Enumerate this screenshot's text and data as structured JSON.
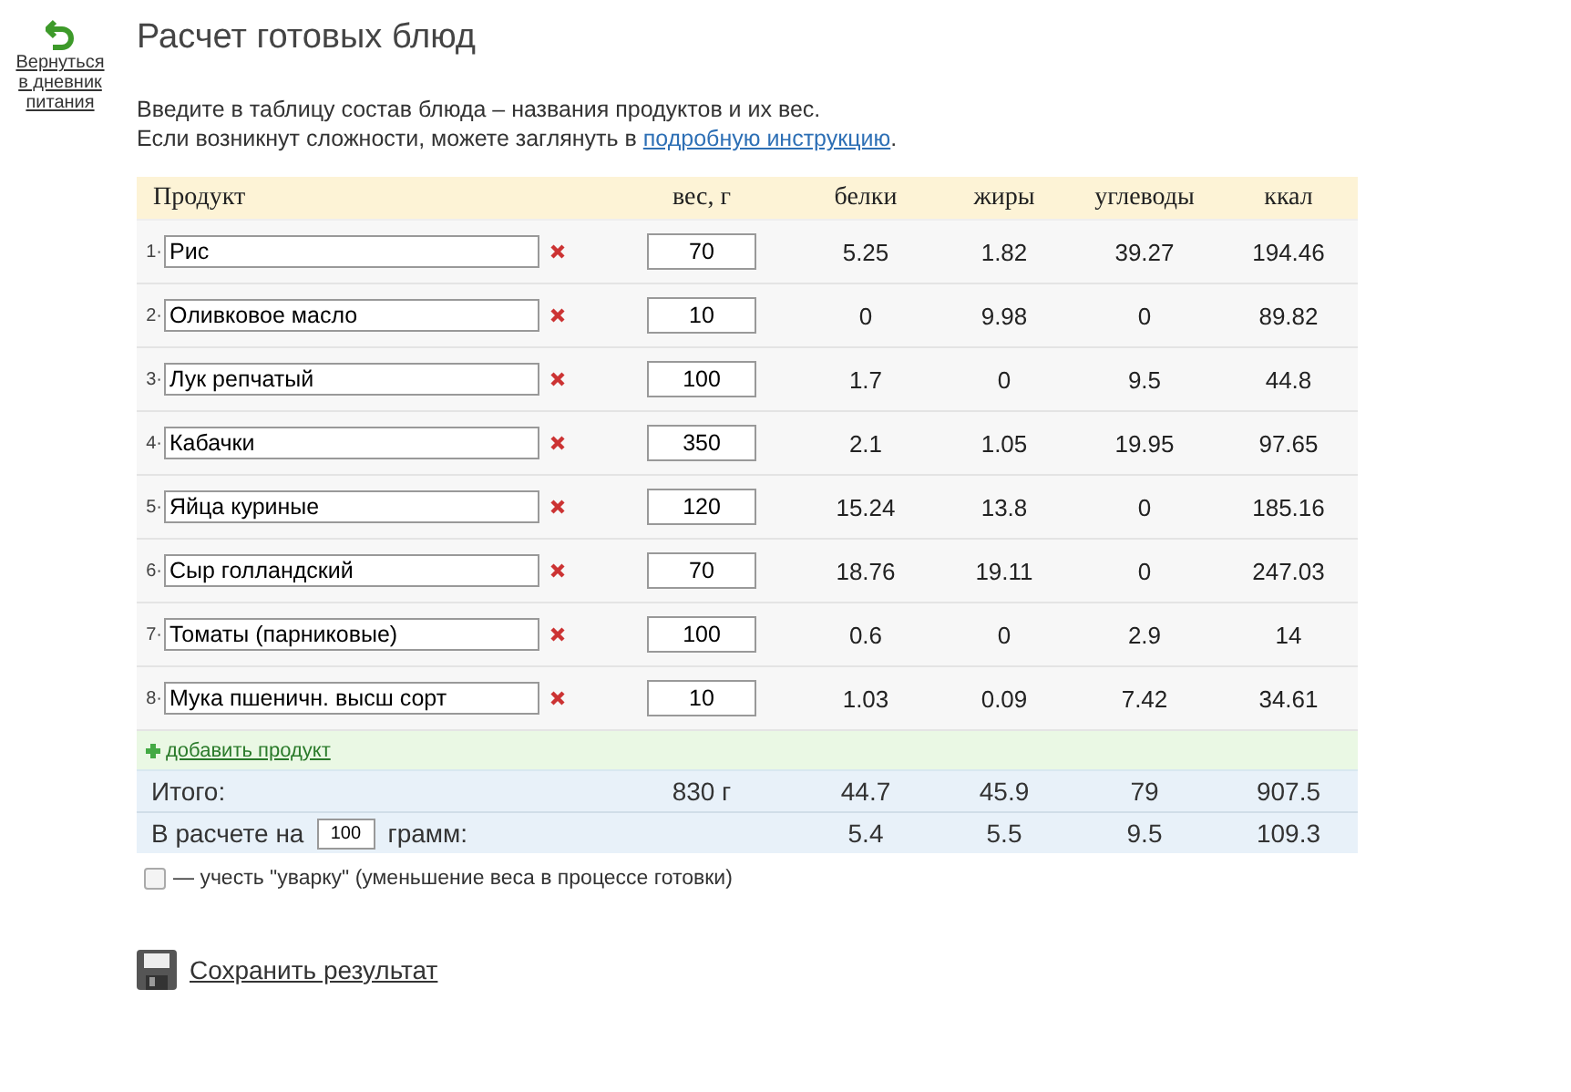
{
  "back_link": "Вернуться в дневник питания",
  "title": "Расчет готовых блюд",
  "intro": {
    "line1": "Введите в таблицу состав блюда – названия продуктов и их вес.",
    "line2": "Если возникнут сложности, можете заглянуть в",
    "link": "подробную инструкцию",
    "end": "."
  },
  "table": {
    "columns": [
      "Продукт",
      "вес, г",
      "белки",
      "жиры",
      "углеводы",
      "ккал"
    ],
    "rows": [
      {
        "number": "1·",
        "product": "Рис",
        "weight": "70",
        "protein": "5.25",
        "fat": "1.82",
        "carbs": "39.27",
        "kcal": "194.46"
      },
      {
        "number": "2·",
        "product": "Оливковое масло",
        "weight": "10",
        "protein": "0",
        "fat": "9.98",
        "carbs": "0",
        "kcal": "89.82"
      },
      {
        "number": "3·",
        "product": "Лук репчатый",
        "weight": "100",
        "protein": "1.7",
        "fat": "0",
        "carbs": "9.5",
        "kcal": "44.8"
      },
      {
        "number": "4·",
        "product": "Кабачки",
        "weight": "350",
        "protein": "2.1",
        "fat": "1.05",
        "carbs": "19.95",
        "kcal": "97.65"
      },
      {
        "number": "5·",
        "product": "Яйца куриные",
        "weight": "120",
        "protein": "15.24",
        "fat": "13.8",
        "carbs": "0",
        "kcal": "185.16"
      },
      {
        "number": "6·",
        "product": "Сыр голландский",
        "weight": "70",
        "protein": "18.76",
        "fat": "19.11",
        "carbs": "0",
        "kcal": "247.03"
      },
      {
        "number": "7·",
        "product": "Томаты (парниковые)",
        "weight": "100",
        "protein": "0.6",
        "fat": "0",
        "carbs": "2.9",
        "kcal": "14"
      },
      {
        "number": "8·",
        "product": "Мука пшеничн. высш сорт",
        "weight": "10",
        "protein": "1.03",
        "fat": "0.09",
        "carbs": "7.42",
        "kcal": "34.61"
      }
    ],
    "add_product": "добавить продукт",
    "total": {
      "label": "Итого:",
      "weight": "830 г",
      "protein": "44.7",
      "fat": "45.9",
      "carbs": "79",
      "kcal": "907.5"
    },
    "per": {
      "label": "В расчете на",
      "amount": "100",
      "unit": "грамм:",
      "protein": "5.4",
      "fat": "5.5",
      "carbs": "9.5",
      "kcal": "109.3"
    }
  },
  "boil_down": {
    "checked": false,
    "label": "— учесть \"уварку\" (уменьшение веса в процессе готовки)"
  },
  "save": "Сохранить результат"
}
